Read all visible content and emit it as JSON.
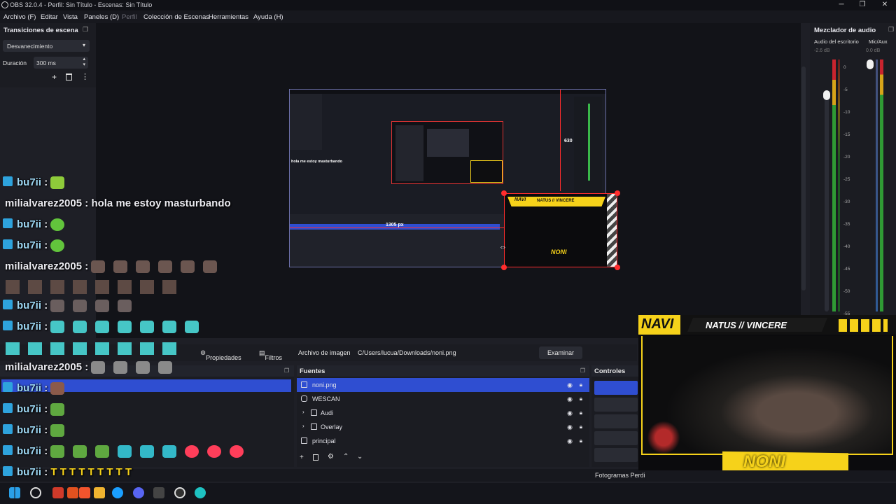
{
  "window": {
    "title": "OBS 32.0.4 - Perfil: Sin Título - Escenas: Sin Título",
    "min": "─",
    "max": "❐",
    "close": "✕"
  },
  "menu": {
    "items": [
      "Archivo (F)",
      "Editar",
      "Vista",
      "Paneles (D)",
      "Perfil",
      "Colección de Escenas",
      "Herramientas",
      "Ayuda (H)"
    ]
  },
  "transitions": {
    "title": "Transiciones de escena",
    "selected": "Desvanecimiento",
    "duration_label": "Duración",
    "duration_value": "300 ms"
  },
  "preview": {
    "label_height": "630 px",
    "label_width": "1305 px",
    "nested_chat_line": "hola me estoy masturbando"
  },
  "mixer": {
    "title": "Mezclador de audio",
    "channels": [
      {
        "name": "Audio del escritorio",
        "db": "-2.6 dB",
        "level": 0.62
      },
      {
        "name": "Mic/Aux",
        "db": "0.0 dB",
        "level": 0.91
      }
    ],
    "scale": [
      "0",
      "-5",
      "-10",
      "-15",
      "-20",
      "-25",
      "-30",
      "-35",
      "-40",
      "-45",
      "-50",
      "-55"
    ]
  },
  "chat": [
    {
      "user": "bu7ii",
      "sep": ":",
      "text": ""
    },
    {
      "user": "milialvarez2005",
      "sep": ":",
      "text": "hola me estoy masturbando"
    },
    {
      "user": "bu7ii",
      "sep": ":",
      "text": ""
    },
    {
      "user": "bu7ii",
      "sep": ":",
      "text": ""
    },
    {
      "user": "milialvarez2005",
      "sep": ":",
      "text": ""
    },
    {
      "user": "bu7ii",
      "sep": ":",
      "text": ""
    },
    {
      "user": "bu7ii",
      "sep": ":",
      "text": ""
    },
    {
      "user": "milialvarez2005",
      "sep": ":",
      "text": ""
    },
    {
      "user": "bu7ii",
      "sep": ":",
      "text": ""
    },
    {
      "user": "bu7ii",
      "sep": ":",
      "text": ""
    },
    {
      "user": "bu7ii",
      "sep": ":",
      "text": ""
    },
    {
      "user": "bu7ii",
      "sep": ":",
      "text": ""
    },
    {
      "user": "bu7ii",
      "sep": ":",
      "text": "T  T  T  T  T  T  T  T  T"
    }
  ],
  "properties_bar": {
    "properties": "Propiedades",
    "filters": "Filtros",
    "image_file_label": "Archivo de imagen",
    "image_path": "C/Users/lucua/Downloads/noni.png",
    "browse": "Examinar"
  },
  "sources": {
    "title": "Fuentes",
    "items": [
      {
        "name": "noni.png",
        "type": "image",
        "selected": true
      },
      {
        "name": "WESCAN",
        "type": "camera",
        "selected": false
      },
      {
        "name": "Audi",
        "type": "group",
        "selected": false
      },
      {
        "name": "Overlay",
        "type": "group",
        "selected": false
      },
      {
        "name": "principal",
        "type": "display",
        "selected": false
      }
    ]
  },
  "controls": {
    "title": "Controles"
  },
  "status": {
    "fps_label": "Fotogramas Perdi"
  },
  "webcam_overlay": {
    "banner": "NATUS // VINCERE",
    "logo": "NAVI",
    "name": "NONI",
    "nested_logo": "NAVI",
    "nested_banner": "NATUS // VINCERE",
    "nested_name": "NONI"
  },
  "colors": {
    "accent": "#2f4ed1",
    "chat_badge": "#2ea3dd",
    "navi_yellow": "#f6d21a",
    "selection_red": "#ff2d2d"
  },
  "taskbar_icons": [
    "windows-icon",
    "search-icon",
    "app-icon-1",
    "app-icon-2",
    "brave-icon",
    "files-icon",
    "steam-icon",
    "discord-icon",
    "app-icon-3",
    "obs-icon",
    "app-icon-4"
  ]
}
